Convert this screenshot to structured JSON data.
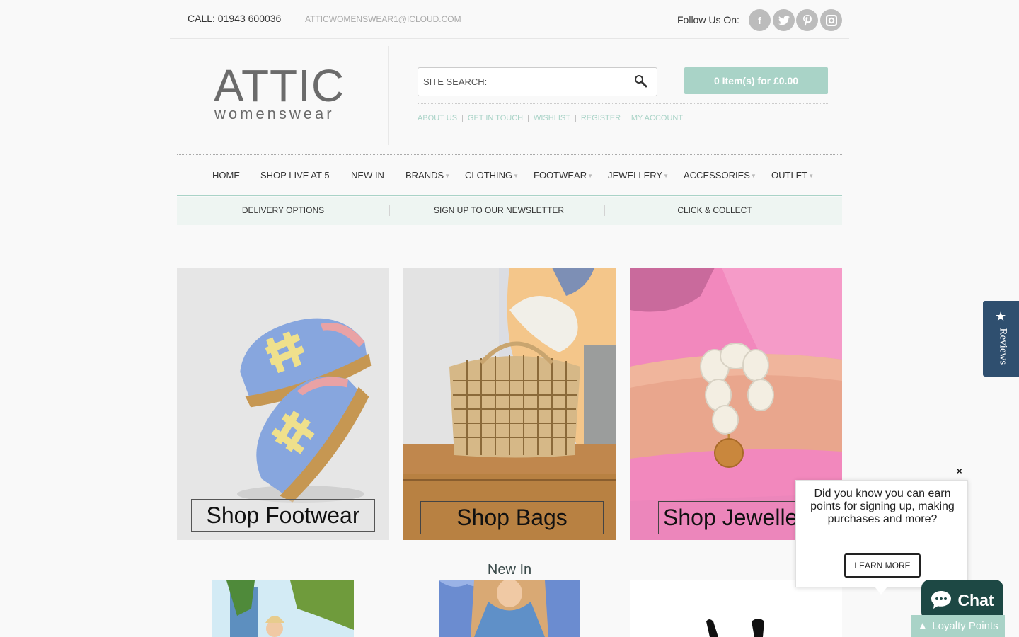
{
  "topbar": {
    "phone": "CALL: 01943 600036",
    "email": "ATTICWOMENSWEAR1@ICLOUD.COM",
    "follow_label": "Follow Us On:",
    "social": [
      {
        "icon": "facebook-icon",
        "glyph": "f"
      },
      {
        "icon": "twitter-icon",
        "glyph": "t"
      },
      {
        "icon": "pinterest-icon",
        "glyph": "p"
      },
      {
        "icon": "instagram-icon",
        "glyph": "◻"
      }
    ]
  },
  "logo": {
    "main": "ATTIC",
    "sub": "womenswear"
  },
  "search": {
    "placeholder": "SITE SEARCH:"
  },
  "cart": {
    "label": "0 Item(s) for £0.00"
  },
  "account_links": [
    "ABOUT US",
    "GET IN TOUCH",
    "WISHLIST",
    "REGISTER",
    "MY ACCOUNT"
  ],
  "nav": [
    {
      "label": "HOME",
      "has_dropdown": false
    },
    {
      "label": "SHOP LIVE AT 5",
      "has_dropdown": false
    },
    {
      "label": "NEW IN",
      "has_dropdown": false
    },
    {
      "label": "BRANDS",
      "has_dropdown": true
    },
    {
      "label": "CLOTHING",
      "has_dropdown": true
    },
    {
      "label": "FOOTWEAR",
      "has_dropdown": true
    },
    {
      "label": "JEWELLERY",
      "has_dropdown": true
    },
    {
      "label": "ACCESSORIES",
      "has_dropdown": true
    },
    {
      "label": "OUTLET",
      "has_dropdown": true
    }
  ],
  "subnav": [
    "DELIVERY OPTIONS",
    "SIGN UP TO OUR NEWSLETTER",
    "CLICK & COLLECT"
  ],
  "tiles": [
    {
      "label": "Shop Footwear"
    },
    {
      "label": "Shop Bags"
    },
    {
      "label": "Shop Jewelle"
    }
  ],
  "new_in": {
    "heading": "New In"
  },
  "reviews_tab": {
    "label": "Reviews"
  },
  "popup": {
    "text": "Did you know you can earn points for signing up, making purchases and more?",
    "button": "LEARN MORE",
    "close": "×"
  },
  "chat": {
    "label": "Chat"
  },
  "loyalty": {
    "label": "Loyalty Points"
  },
  "colors": {
    "accent": "#a9d3c7",
    "reviews": "#2f4f6f",
    "chat": "#1d4844"
  }
}
